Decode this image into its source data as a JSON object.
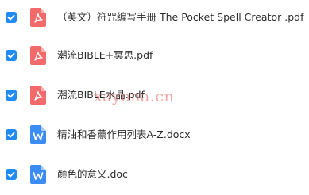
{
  "colors": {
    "checkbox": "#1f8bf3",
    "pdf_icon": "#f26a6a",
    "word_icon": "#3b8cf5",
    "text": "#2b2b2b",
    "watermark": "#e85d5d"
  },
  "files": [
    {
      "name": "（英文）符咒编写手册 The Pocket Spell Creator .pdf",
      "type": "pdf",
      "icon": "pdf-file-icon",
      "checked": true
    },
    {
      "name": "潮流BIBLE+冥思.pdf",
      "type": "pdf",
      "icon": "pdf-file-icon",
      "checked": true
    },
    {
      "name": "潮流BIBLE水晶.pdf",
      "type": "pdf",
      "icon": "pdf-file-icon",
      "checked": true
    },
    {
      "name": "精油和香薰作用列表A-Z.docx",
      "type": "docx",
      "icon": "word-file-icon",
      "checked": true
    },
    {
      "name": "颜色的意义.doc",
      "type": "doc",
      "icon": "word-file-icon",
      "checked": true
    }
  ],
  "watermark": {
    "text": "xayona.cn"
  }
}
